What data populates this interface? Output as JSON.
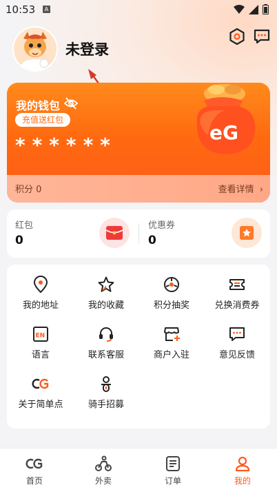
{
  "status_bar": {
    "time": "10:53",
    "notification_badge": "A"
  },
  "header": {
    "login_text": "未登录"
  },
  "wallet": {
    "title": "我的钱包",
    "recharge_label": "充值送红包",
    "balance_masked": "******",
    "points_label": "积分 0",
    "details_label": "查看详情",
    "bag_logo": "eG"
  },
  "coupons": {
    "red_packet": {
      "label": "红包",
      "value": "0"
    },
    "discount_coupon": {
      "label": "优惠券",
      "value": "0"
    }
  },
  "services": [
    {
      "label": "我的地址",
      "icon": "location-icon"
    },
    {
      "label": "我的收藏",
      "icon": "star-icon"
    },
    {
      "label": "积分抽奖",
      "icon": "lottery-icon"
    },
    {
      "label": "兑换消费券",
      "icon": "ticket-icon"
    },
    {
      "label": "语言",
      "icon": "language-icon"
    },
    {
      "label": "联系客服",
      "icon": "headset-icon"
    },
    {
      "label": "商户入驻",
      "icon": "store-icon"
    },
    {
      "label": "意见反馈",
      "icon": "feedback-icon"
    },
    {
      "label": "关于简单点",
      "icon": "about-icon"
    },
    {
      "label": "骑手招募",
      "icon": "rider-icon"
    }
  ],
  "tabs": [
    {
      "label": "首页",
      "icon": "home-icon"
    },
    {
      "label": "外卖",
      "icon": "delivery-icon"
    },
    {
      "label": "订单",
      "icon": "order-icon"
    },
    {
      "label": "我的",
      "icon": "profile-icon"
    }
  ],
  "colors": {
    "accent": "#ff5a1a",
    "wallet_top": "#ff8a1c"
  }
}
